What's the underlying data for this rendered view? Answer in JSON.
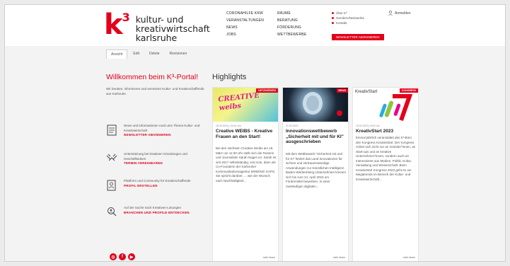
{
  "brand": {
    "k": "k",
    "sup": "3",
    "line1": "kultur- und",
    "line2": "kreativwirtschaft",
    "line3": "karlsruhe"
  },
  "nav": [
    "CORONAHILFE KKW",
    "RÄUME",
    "VERANSTALTUNGEN",
    "BERATUNG",
    "NEWS",
    "FÖRDERUNG",
    "JOBS",
    "WETTBEWERBE"
  ],
  "utility": [
    "Über K³",
    "Gendern/Netzwerke",
    "Kontakt"
  ],
  "newsletter_button": "NEWSLETTER ABONNIEREN",
  "login": "Anmelden",
  "tabs": [
    "Ansicht",
    "Edit",
    "Delete",
    "Revisionen"
  ],
  "welcome": {
    "title": "Willkommen beim K³-Portal!",
    "text": "Wir beraten, informieren und vernetzen Kultur- und Kreativschaffende aus Karlsruhe."
  },
  "features": [
    {
      "icon": "newsletter-icon",
      "text": "News und Informationen rund ums Thema Kultur- und Kreativwirtschaft",
      "link": "NEWSLETTER ABONNIEREN"
    },
    {
      "icon": "handshake-icon",
      "text": "Unterstützung bei kreativen Gründungen und Geschäftsideen",
      "link": "TERMIN VEREINBAREN"
    },
    {
      "icon": "profile-icon",
      "text": "Plattform und Community für Kreativschaffende",
      "link": "PROFIL ERSTELLEN"
    },
    {
      "icon": "search-people-icon",
      "text": "Auf der Suche nach Kreativen-Lösungen",
      "link": "BRANCHEN UND PROFILE ENTDECKEN"
    }
  ],
  "social": [
    "instagram-icon",
    "facebook-icon",
    "youtube-icon"
  ],
  "highlights_title": "Highlights",
  "cards": [
    {
      "badge": "NETZWERKEN",
      "img_text": "CREATIVE weibs",
      "date": "16.03.2023 | 19:00 Uhr",
      "title": "Creative WEIBS - Kreative Frauen an den Start!",
      "body": "Bei den nächsten Creative Weibs am 16. März um 11:30 Uhr stellt sich die Texterin und Journalistin Sarah Nagel vor. Sarah ist seit 2017 selbstständig, erst solo, dann als Co-Founderin der Karlsruher Kommunikationsagentur MINDING GAPS. Sie spricht darüber, ... wie der Wunsch nach Nachhaltigkeit...",
      "more": "mehr lesen"
    },
    {
      "badge": "NEWS",
      "img_text": "",
      "date": "21.03.2023",
      "title": "Innovationswettbewerb „Sicherheit mit und für KI\" ausgeschrieben",
      "body": "Mit dem Wettbewerb \"Sicherheit mit und für KI\" fördert das Land Innovationen für sichere und vertrauenswürdige Anwendungen zur Künstlichen Intelligenz. Baden-Württemberg Unternehmen können sich bis zum 24. April 2023 um Fördermittel bewerben. In einer zweistufigen digitalen...",
      "more": "mehr lesen"
    },
    {
      "badge": "KONGRESS",
      "img_text": "KreativStart",
      "date": "19.03.2023 | 9:00 Uhr",
      "title": "KreativStart 2023",
      "body": "Einmal jährlich veranstaltet das K³-Büro den Kongress KreativStart. Der Kongress richtet sich nicht nur an Gründer*innen, an Start-ups und an kreative Unternehmer*innen, sondern auch an Interessierte aus Medien, Politik, Kultur, Verwaltung und Wissenschaft. Beim KreativStart Kongress 2023 geht es um Megatrends im Bereich der Kultur- und Kreativwirtschaft...",
      "more": "mehr lesen"
    }
  ],
  "colors": {
    "accent": "#e2001a",
    "background": "#f3f3f3"
  }
}
